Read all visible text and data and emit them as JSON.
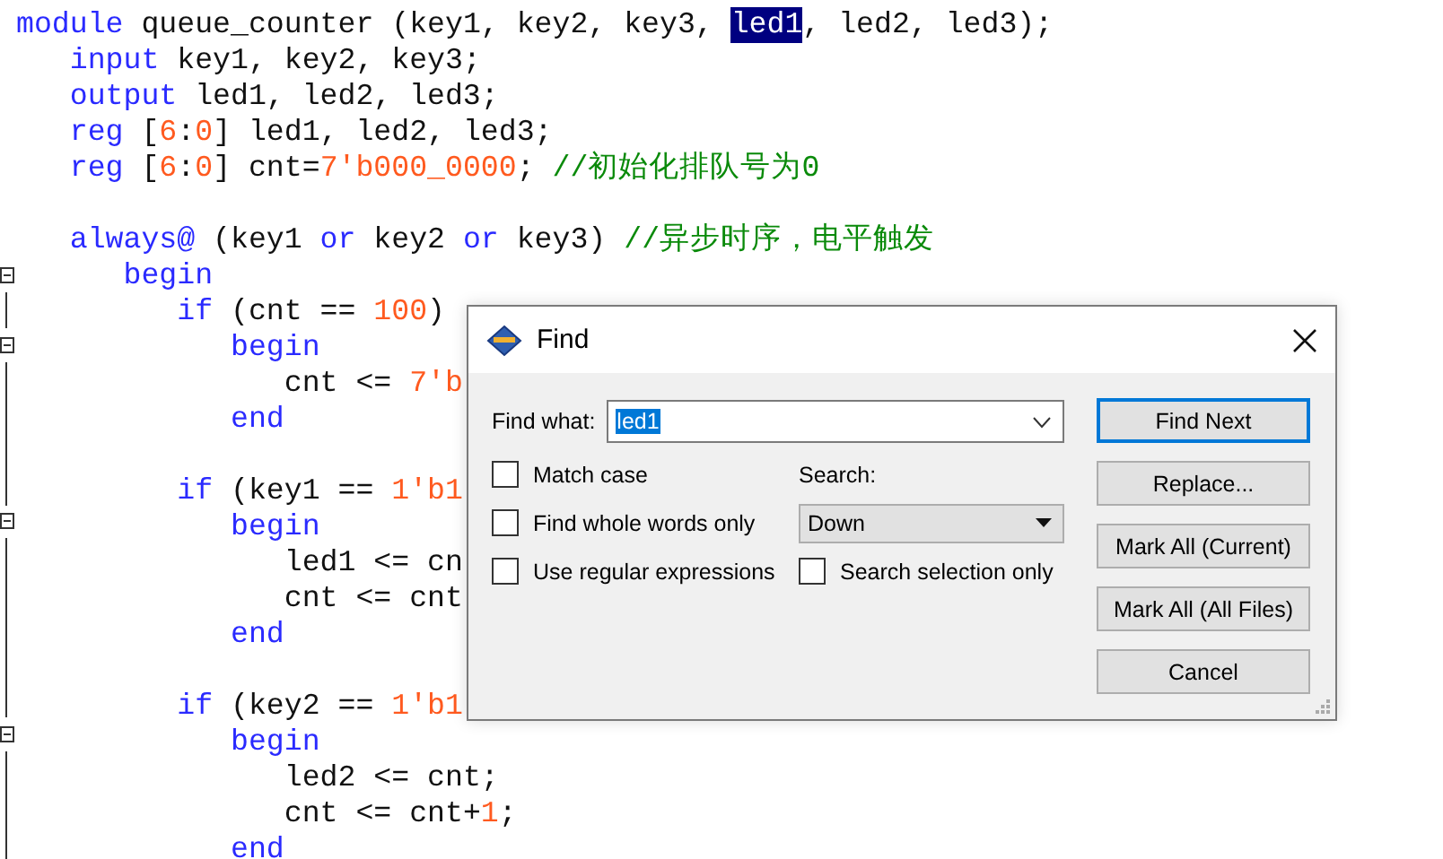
{
  "editor": {
    "lines": [
      {
        "foldable": false,
        "tokens": [
          {
            "kind": "keyword",
            "text": "module"
          },
          {
            "kind": "plain",
            "text": " queue_counter (key1, key2, key3, "
          },
          {
            "kind": "plain",
            "text": "led1",
            "selected": true
          },
          {
            "kind": "plain",
            "text": ", led2, led3);"
          }
        ],
        "children": [
          {
            "foldable": false,
            "tokens": [
              {
                "kind": "keyword",
                "text": "input"
              },
              {
                "kind": "plain",
                "text": " key1, key2, key3;"
              }
            ]
          },
          {
            "foldable": false,
            "tokens": [
              {
                "kind": "keyword",
                "text": "output"
              },
              {
                "kind": "plain",
                "text": " led1, led2, led3;"
              }
            ]
          },
          {
            "foldable": false,
            "tokens": [
              {
                "kind": "keyword",
                "text": "reg"
              },
              {
                "kind": "plain",
                "text": " ["
              },
              {
                "kind": "number",
                "text": "6"
              },
              {
                "kind": "plain",
                "text": ":"
              },
              {
                "kind": "number",
                "text": "0"
              },
              {
                "kind": "plain",
                "text": "] led1, led2, led3;"
              }
            ]
          },
          {
            "foldable": false,
            "tokens": [
              {
                "kind": "keyword",
                "text": "reg"
              },
              {
                "kind": "plain",
                "text": " ["
              },
              {
                "kind": "number",
                "text": "6"
              },
              {
                "kind": "plain",
                "text": ":"
              },
              {
                "kind": "number",
                "text": "0"
              },
              {
                "kind": "plain",
                "text": "] cnt="
              },
              {
                "kind": "number",
                "text": "7'b000_0000"
              },
              {
                "kind": "plain",
                "text": "; "
              },
              {
                "kind": "comment",
                "text": "//初始化排队号为0"
              }
            ]
          },
          {
            "foldable": false
          },
          {
            "foldable": false,
            "tokens": [
              {
                "kind": "keyword",
                "text": "always@"
              },
              {
                "kind": "plain",
                "text": " (key1 "
              },
              {
                "kind": "keyword",
                "text": "or"
              },
              {
                "kind": "plain",
                "text": " key2 "
              },
              {
                "kind": "keyword",
                "text": "or"
              },
              {
                "kind": "plain",
                "text": " key3) "
              },
              {
                "kind": "comment",
                "text": "//异步时序，电平触发"
              }
            ],
            "children": [
              {
                "foldable": true,
                "tokens": [
                  {
                    "kind": "keyword",
                    "text": "begin"
                  }
                ],
                "children": [
                  {
                    "foldable": false,
                    "tokens": [
                      {
                        "kind": "keyword",
                        "text": "if"
                      },
                      {
                        "kind": "plain",
                        "text": " (cnt == "
                      },
                      {
                        "kind": "number",
                        "text": "100"
                      },
                      {
                        "kind": "plain",
                        "text": ")"
                      }
                    ],
                    "children": [
                      {
                        "foldable": true,
                        "tokens": [
                          {
                            "kind": "keyword",
                            "text": "begin"
                          }
                        ],
                        "children": [
                          {
                            "foldable": false,
                            "tokens": [
                              {
                                "kind": "plain",
                                "text": "cnt <= "
                              },
                              {
                                "kind": "number",
                                "text": "7'b"
                              }
                            ]
                          }
                        ]
                      },
                      {
                        "foldable": false,
                        "tokens": [
                          {
                            "kind": "keyword",
                            "text": "end"
                          }
                        ]
                      }
                    ]
                  },
                  {
                    "foldable": false
                  },
                  {
                    "foldable": false,
                    "tokens": [
                      {
                        "kind": "keyword",
                        "text": "if"
                      },
                      {
                        "kind": "plain",
                        "text": " (key1 == "
                      },
                      {
                        "kind": "number",
                        "text": "1'b1"
                      }
                    ],
                    "children": [
                      {
                        "foldable": true,
                        "tokens": [
                          {
                            "kind": "keyword",
                            "text": "begin"
                          }
                        ],
                        "children": [
                          {
                            "foldable": false,
                            "tokens": [
                              {
                                "kind": "plain",
                                "text": "led1 <= cn"
                              }
                            ]
                          },
                          {
                            "foldable": false,
                            "tokens": [
                              {
                                "kind": "plain",
                                "text": "cnt <= cnt"
                              }
                            ]
                          }
                        ]
                      },
                      {
                        "foldable": false,
                        "tokens": [
                          {
                            "kind": "keyword",
                            "text": "end"
                          }
                        ]
                      }
                    ]
                  },
                  {
                    "foldable": false
                  },
                  {
                    "foldable": false,
                    "tokens": [
                      {
                        "kind": "keyword",
                        "text": "if"
                      },
                      {
                        "kind": "plain",
                        "text": " (key2 == "
                      },
                      {
                        "kind": "number",
                        "text": "1'b1"
                      }
                    ],
                    "children": [
                      {
                        "foldable": true,
                        "tokens": [
                          {
                            "kind": "keyword",
                            "text": "begin"
                          }
                        ],
                        "children": [
                          {
                            "foldable": false,
                            "tokens": [
                              {
                                "kind": "plain",
                                "text": "led2 <= cnt;"
                              }
                            ]
                          },
                          {
                            "foldable": false,
                            "tokens": [
                              {
                                "kind": "plain",
                                "text": "cnt <= cnt+"
                              },
                              {
                                "kind": "number",
                                "text": "1"
                              },
                              {
                                "kind": "plain",
                                "text": ";"
                              }
                            ]
                          }
                        ]
                      },
                      {
                        "foldable": false,
                        "tokens": [
                          {
                            "kind": "keyword",
                            "text": "end"
                          }
                        ]
                      }
                    ]
                  }
                ]
              }
            ]
          }
        ]
      }
    ]
  },
  "find_dialog": {
    "title": "Find",
    "find_what": {
      "label": "Find what:",
      "value": "led1"
    },
    "options": [
      {
        "label": "Match case",
        "checked": false
      },
      {
        "label": "Find whole words only",
        "checked": false
      },
      {
        "label": "Use regular expressions",
        "checked": false
      }
    ],
    "search": {
      "label": "Search:",
      "value": "Down"
    },
    "search_selection": {
      "label": "Search selection only",
      "checked": false
    },
    "buttons": [
      {
        "label": "Find Next",
        "default": true
      },
      {
        "label": "Replace...",
        "default": false
      },
      {
        "label": "Mark All (Current)",
        "default": false
      },
      {
        "label": "Mark All (All Files)",
        "default": false
      },
      {
        "label": "Cancel",
        "default": false
      }
    ]
  }
}
